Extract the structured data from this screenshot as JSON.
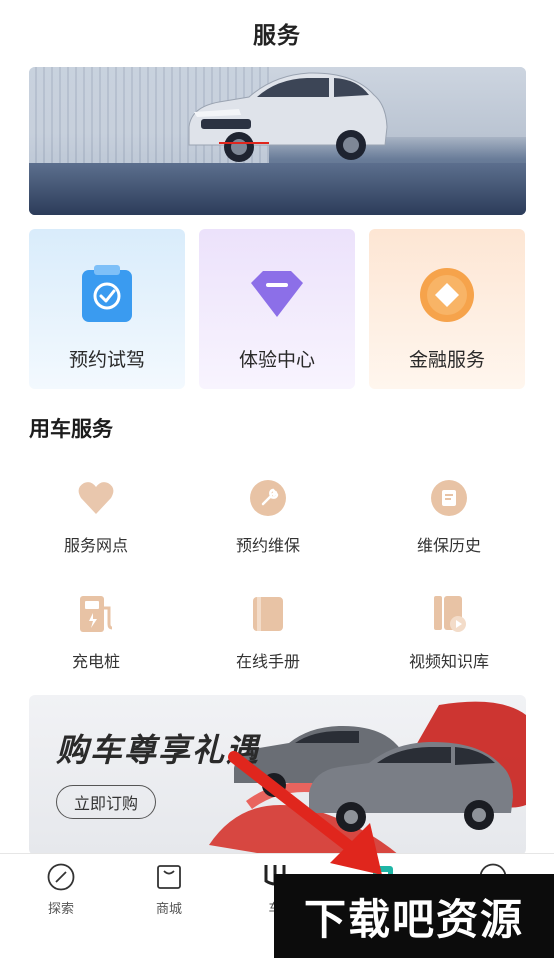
{
  "header": {
    "title": "服务"
  },
  "quick_cards": [
    {
      "label": "预约试驾",
      "icon": "clipboard-check-icon",
      "color": "#3a9bf0"
    },
    {
      "label": "体验中心",
      "icon": "diamond-icon",
      "color": "#8c6fe8"
    },
    {
      "label": "金融服务",
      "icon": "coin-icon",
      "color": "#f6a34b"
    }
  ],
  "section": {
    "title": "用车服务"
  },
  "services": [
    {
      "label": "服务网点",
      "icon": "heart-icon"
    },
    {
      "label": "预约维保",
      "icon": "wrench-icon"
    },
    {
      "label": "维保历史",
      "icon": "history-icon"
    },
    {
      "label": "充电桩",
      "icon": "charging-pile-icon"
    },
    {
      "label": "在线手册",
      "icon": "manual-icon"
    },
    {
      "label": "视频知识库",
      "icon": "video-library-icon"
    }
  ],
  "promo": {
    "title": "购车尊享礼遇",
    "button_label": "立即订购"
  },
  "bottom_nav": [
    {
      "label": "探索",
      "icon": "compass-icon"
    },
    {
      "label": "商城",
      "icon": "shopping-bag-icon"
    },
    {
      "label": "车",
      "icon": "car-icon"
    },
    {
      "label": "",
      "icon": "service-icon"
    },
    {
      "label": "",
      "icon": "profile-icon"
    }
  ],
  "watermark": {
    "text": "下载吧资源"
  },
  "colors": {
    "accent_blue": "#3a9bf0",
    "accent_purple": "#8c6fe8",
    "accent_orange": "#f6a34b",
    "arrow_red": "#e0261d",
    "service_gold": "#e8c3a5"
  }
}
